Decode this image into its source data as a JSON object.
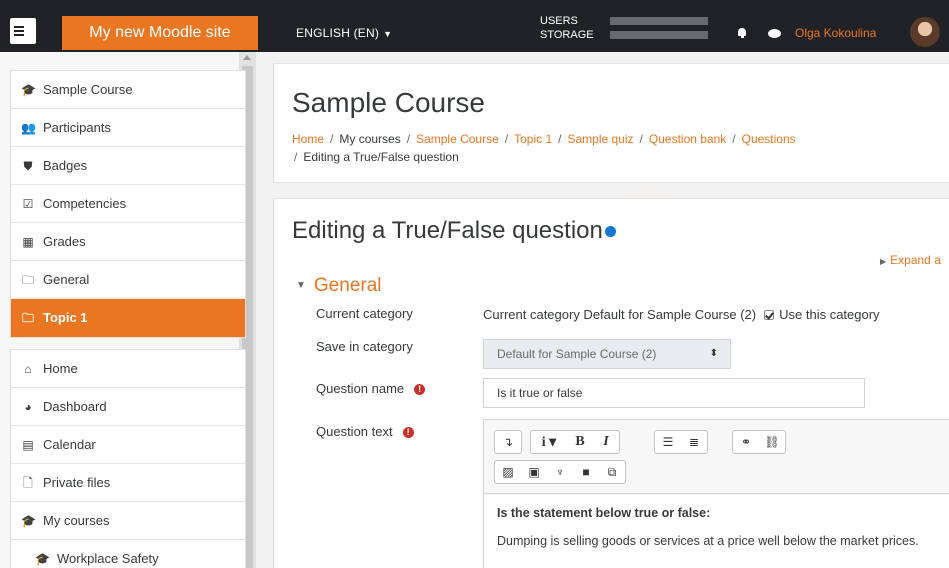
{
  "navbar": {
    "site_name": "My new Moodle site",
    "language": "ENGLISH (EN)",
    "quota": [
      {
        "label": "USERS"
      },
      {
        "label": "STORAGE"
      }
    ],
    "user_name": "Olga Kokoulina",
    "accent_color": "#ea7622"
  },
  "sidebar": {
    "course_items": [
      {
        "label": "Sample Course",
        "icon": "graduation-cap-icon"
      },
      {
        "label": "Participants",
        "icon": "users-icon"
      },
      {
        "label": "Badges",
        "icon": "shield-icon"
      },
      {
        "label": "Competencies",
        "icon": "checkbox-icon"
      },
      {
        "label": "Grades",
        "icon": "table-icon"
      },
      {
        "label": "General",
        "icon": "folder-icon"
      },
      {
        "label": "Topic 1",
        "icon": "folder-icon",
        "active": true
      }
    ],
    "site_items": [
      {
        "label": "Home",
        "icon": "home-icon"
      },
      {
        "label": "Dashboard",
        "icon": "dashboard-icon"
      },
      {
        "label": "Calendar",
        "icon": "calendar-icon"
      },
      {
        "label": "Private files",
        "icon": "file-icon"
      },
      {
        "label": "My courses",
        "icon": "graduation-cap-icon"
      },
      {
        "label": "Workplace Safety",
        "icon": "graduation-cap-icon"
      }
    ]
  },
  "header": {
    "title": "Sample Course",
    "breadcrumb": [
      "Home",
      "My courses",
      "Sample Course",
      "Topic 1",
      "Sample quiz",
      "Question bank",
      "Questions",
      "Editing a True/False question"
    ]
  },
  "form": {
    "heading": "Editing a True/False question",
    "expand_all": "Expand a",
    "section": "General",
    "current_category_label": "Current category",
    "current_category_value": "Current category  Default for Sample Course (2)",
    "use_category_label": "Use this category",
    "save_in_category_label": "Save in category",
    "save_in_category_value": "Default for Sample Course (2)",
    "question_name_label": "Question name",
    "question_name_value": "Is it true or false",
    "question_text_label": "Question text",
    "editor_heading": "Is the statement below true or false:",
    "editor_text": "Dumping is selling goods or services at a price well below the market prices."
  }
}
